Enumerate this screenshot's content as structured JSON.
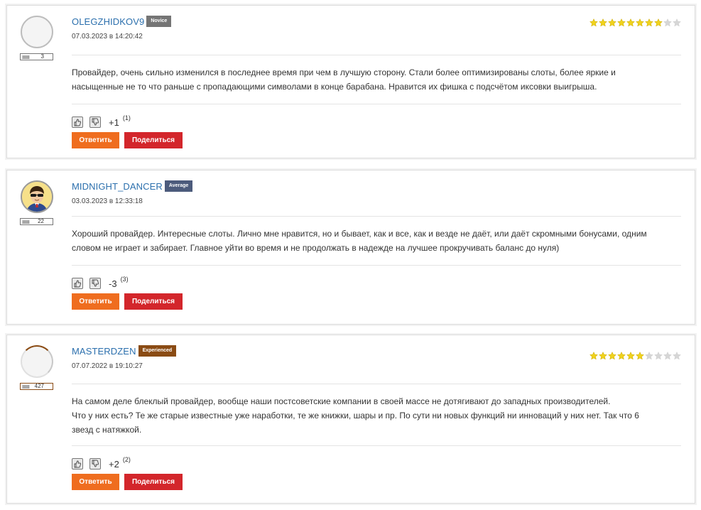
{
  "reply_label": "Ответить",
  "share_label": "Поделиться",
  "colors": {
    "username": "#2b6fad",
    "reply_button": "#ef6d1f",
    "share_button": "#d3262b",
    "star_filled": "#f0d21c",
    "star_empty": "#d6d6d6"
  },
  "reviews": [
    {
      "username": "OLEGZHIDKOV9",
      "badge": "Novice",
      "badge_color": "#757575",
      "date": "07.03.2023 в 14:20:42",
      "rank": "3",
      "rating": 8,
      "rating_max": 10,
      "text_lines": [
        "Провайдер, очень сильно изменился в последнее время при чем в лучшую сторону. Стали более оптимизированы слоты, более яркие и",
        "насыщенные не то что раньше с пропадающими символами в конце барабана. Нравится их фишка с подсчётом иксовки выигрыша."
      ],
      "score": "+1",
      "votes": "(1)",
      "avatar": "blank"
    },
    {
      "username": "MIDNIGHT_DANCER",
      "badge": "Average",
      "badge_color": "#4c5b7c",
      "date": "03.03.2023 в 12:33:18",
      "rank": "22",
      "rating": null,
      "rating_max": 10,
      "text_lines": [
        "Хороший провайдер. Интересные слоты. Лично мне нравится, но и бывает, как и все, как и везде не даёт, или даёт скромными бонусами, одним",
        "словом не играет и забирает. Главное уйти во время и не продолжать в надежде на лучшее прокручивать баланс до нуля)"
      ],
      "score": "-3",
      "votes": "(3)",
      "avatar": "cartoon"
    },
    {
      "username": "MASTERDZEN",
      "badge": "Experienced",
      "badge_color": "#8a4b14",
      "date": "07.07.2022 в 19:10:27",
      "rank": "427",
      "rating": 6,
      "rating_max": 10,
      "text_lines": [
        "На самом деле блеклый провайдер, вообще наши постсоветские компании в своей массе не дотягивают до западных производителей.",
        "Что у них есть? Те же старые известные уже наработки, те же книжки, шары и пр. По сути ни новых функций ни инноваций у них нет. Так что 6",
        "звезд с натяжкой."
      ],
      "score": "+2",
      "votes": "(2)",
      "avatar": "blank"
    }
  ]
}
